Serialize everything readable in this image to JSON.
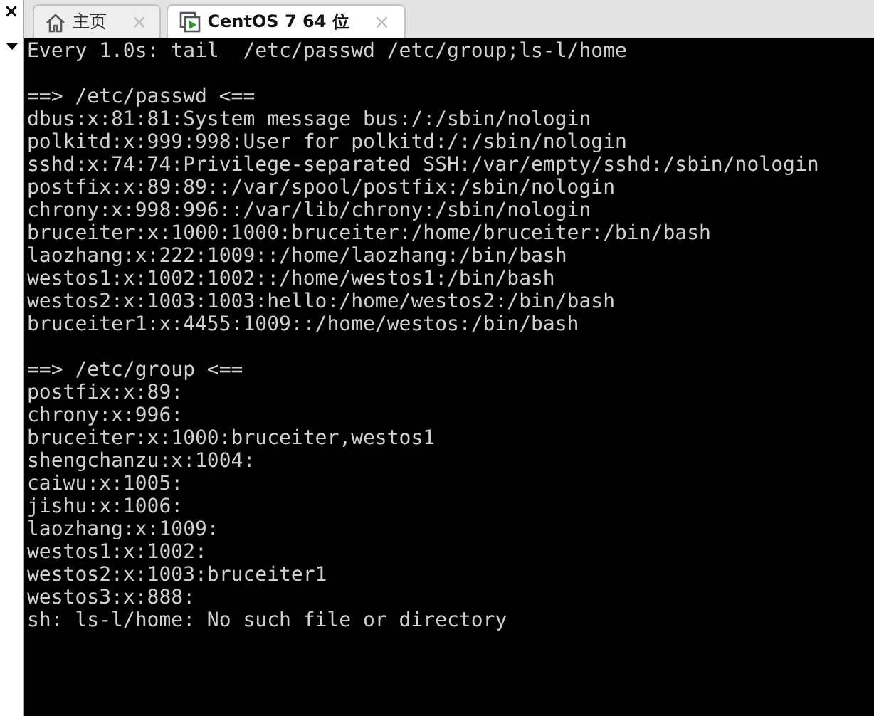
{
  "side_panel": {
    "close": "×"
  },
  "tabs": [
    {
      "kind": "home",
      "label": "主页",
      "close": "×",
      "selected": false
    },
    {
      "kind": "vm",
      "label": "CentOS 7 64 位",
      "close": "×",
      "selected": true
    }
  ],
  "terminal": {
    "header": "Every 1.0s: tail  /etc/passwd /etc/group;ls-l/home",
    "blocks": [
      {
        "heading": "==> /etc/passwd <==",
        "lines": [
          "dbus:x:81:81:System message bus:/:/sbin/nologin",
          "polkitd:x:999:998:User for polkitd:/:/sbin/nologin",
          "sshd:x:74:74:Privilege-separated SSH:/var/empty/sshd:/sbin/nologin",
          "postfix:x:89:89::/var/spool/postfix:/sbin/nologin",
          "chrony:x:998:996::/var/lib/chrony:/sbin/nologin",
          "bruceiter:x:1000:1000:bruceiter:/home/bruceiter:/bin/bash",
          "laozhang:x:222:1009::/home/laozhang:/bin/bash",
          "westos1:x:1002:1002::/home/westos1:/bin/bash",
          "westos2:x:1003:1003:hello:/home/westos2:/bin/bash",
          "bruceiter1:x:4455:1009::/home/westos:/bin/bash"
        ]
      },
      {
        "heading": "==> /etc/group <==",
        "lines": [
          "postfix:x:89:",
          "chrony:x:996:",
          "bruceiter:x:1000:bruceiter,westos1",
          "shengchanzu:x:1004:",
          "caiwu:x:1005:",
          "jishu:x:1006:",
          "laozhang:x:1009:",
          "westos1:x:1002:",
          "westos2:x:1003:bruceiter1",
          "westos3:x:888:"
        ]
      }
    ],
    "error": "sh: ls-l/home: No such file or directory"
  }
}
